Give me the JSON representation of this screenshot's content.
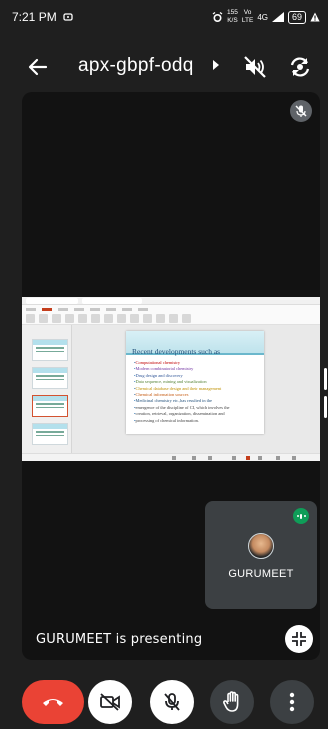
{
  "status_bar": {
    "time": "7:21 PM",
    "speed_value": "155",
    "speed_unit": "K/S",
    "volte_top": "Vo",
    "volte_bottom": "LTE",
    "network": "4G",
    "battery": "69"
  },
  "header": {
    "meeting_code": "apx-gbpf-odq"
  },
  "slide": {
    "heading": "Recent developments such as",
    "bullets": [
      "Computational chemistry",
      "Modern combinatorial chemistry",
      "Drug design and discovery",
      "Data sequence, mining and visualization",
      "Chemical database design and their management",
      "Chemical information sources",
      "Medicinal chemistry etc.,has resulted in the",
      "emergence of the discipline of CI, which involves the",
      "creation, retrieval, organization, dissemination and",
      "processing of chemical information."
    ]
  },
  "participant": {
    "name": "GURUMEET"
  },
  "presenting_text": "GURUMEET is presenting",
  "colors": {
    "background": "#1f1f1f",
    "stage": "#121212",
    "end_call": "#ea4335",
    "tile": "#3c4043",
    "speaking": "#0f9d58"
  },
  "icons": [
    "back-arrow-icon",
    "caret-right-icon",
    "speaker-off-icon",
    "switch-camera-icon",
    "mic-off-icon",
    "speaking-indicator-icon",
    "collapse-icon",
    "end-call-icon",
    "camera-off-icon",
    "raise-hand-icon",
    "more-options-icon"
  ]
}
